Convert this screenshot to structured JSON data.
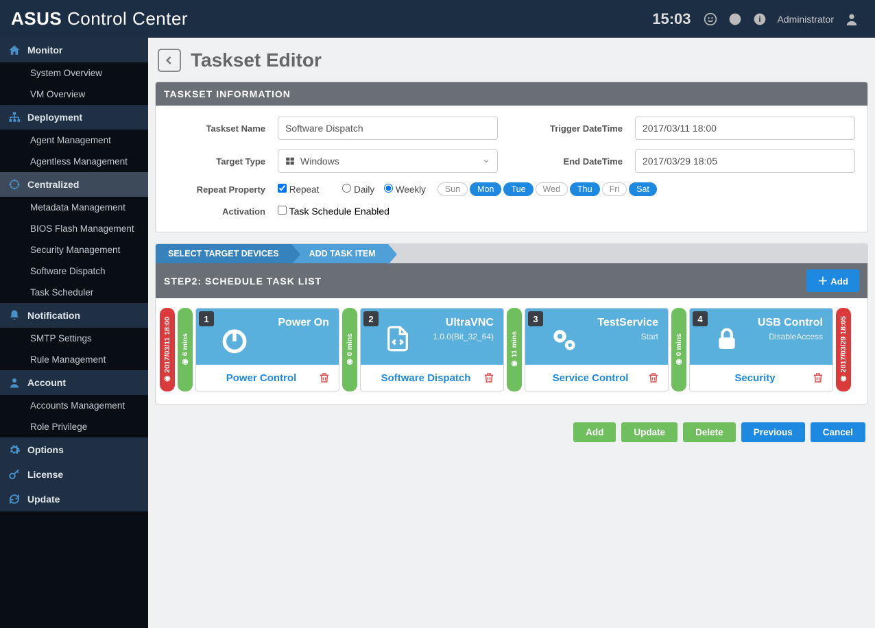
{
  "header": {
    "brand_prefix": "ASUS",
    "brand_main": "Control",
    "brand_suffix": "Center",
    "time": "15:03",
    "username": "Administrator"
  },
  "sidebar": {
    "sections": [
      {
        "label": "Monitor",
        "icon": "home",
        "items": [
          "System Overview",
          "VM Overview"
        ]
      },
      {
        "label": "Deployment",
        "icon": "sitemap",
        "items": [
          "Agent Management",
          "Agentless Management"
        ]
      },
      {
        "label": "Centralized",
        "icon": "target",
        "selected": true,
        "items": [
          "Metadata Management",
          "BIOS Flash Management",
          "Security Management",
          "Software Dispatch",
          "Task Scheduler"
        ]
      },
      {
        "label": "Notification",
        "icon": "bell",
        "items": [
          "SMTP Settings",
          "Rule Management"
        ]
      },
      {
        "label": "Account",
        "icon": "user",
        "items": [
          "Accounts Management",
          "Role Privilege"
        ]
      },
      {
        "label": "Options",
        "icon": "gear",
        "items": []
      },
      {
        "label": "License",
        "icon": "key",
        "items": []
      },
      {
        "label": "Update",
        "icon": "refresh",
        "items": []
      }
    ]
  },
  "page": {
    "title": "Taskset Editor",
    "panel_title": "TASKSET INFORMATION",
    "form": {
      "taskset_name_label": "Taskset Name",
      "taskset_name_value": "Software Dispatch",
      "trigger_label": "Trigger DateTime",
      "trigger_value": "2017/03/11 18:00",
      "target_type_label": "Target Type",
      "target_type_value": "Windows",
      "end_label": "End DateTime",
      "end_value": "2017/03/29 18:05",
      "repeat_label": "Repeat Property",
      "repeat_checkbox": "Repeat",
      "daily_label": "Daily",
      "weekly_label": "Weekly",
      "days": [
        {
          "label": "Sun",
          "on": false
        },
        {
          "label": "Mon",
          "on": true
        },
        {
          "label": "Tue",
          "on": true
        },
        {
          "label": "Wed",
          "on": false
        },
        {
          "label": "Thu",
          "on": true
        },
        {
          "label": "Fri",
          "on": false
        },
        {
          "label": "Sat",
          "on": true
        }
      ],
      "activation_label": "Activation",
      "activation_checkbox": "Task Schedule Enabled"
    },
    "wizard": {
      "tab1": "SELECT TARGET DEVICES",
      "tab2": "ADD TASK ITEM"
    },
    "step_title": "STEP2: SCHEDULE TASK LIST",
    "add_button": "Add",
    "timeline": {
      "start_marker": "2017/03/11 18:00",
      "end_marker": "2017/03/29 18:05",
      "gaps": [
        "6 mins",
        "0 mins",
        "11 mins",
        "0 mins"
      ],
      "cards": [
        {
          "num": "1",
          "title": "Power On",
          "sub": "",
          "category": "Power Control",
          "icon": "power"
        },
        {
          "num": "2",
          "title": "UltraVNC",
          "sub": "1.0.0(Bit_32_64)",
          "category": "Software Dispatch",
          "icon": "code"
        },
        {
          "num": "3",
          "title": "TestService",
          "sub": "Start",
          "category": "Service Control",
          "icon": "gears"
        },
        {
          "num": "4",
          "title": "USB Control",
          "sub": "DisableAccess",
          "category": "Security",
          "icon": "lock"
        }
      ]
    },
    "footer": {
      "add": "Add",
      "update": "Update",
      "delete": "Delete",
      "previous": "Previous",
      "cancel": "Cancel"
    }
  }
}
